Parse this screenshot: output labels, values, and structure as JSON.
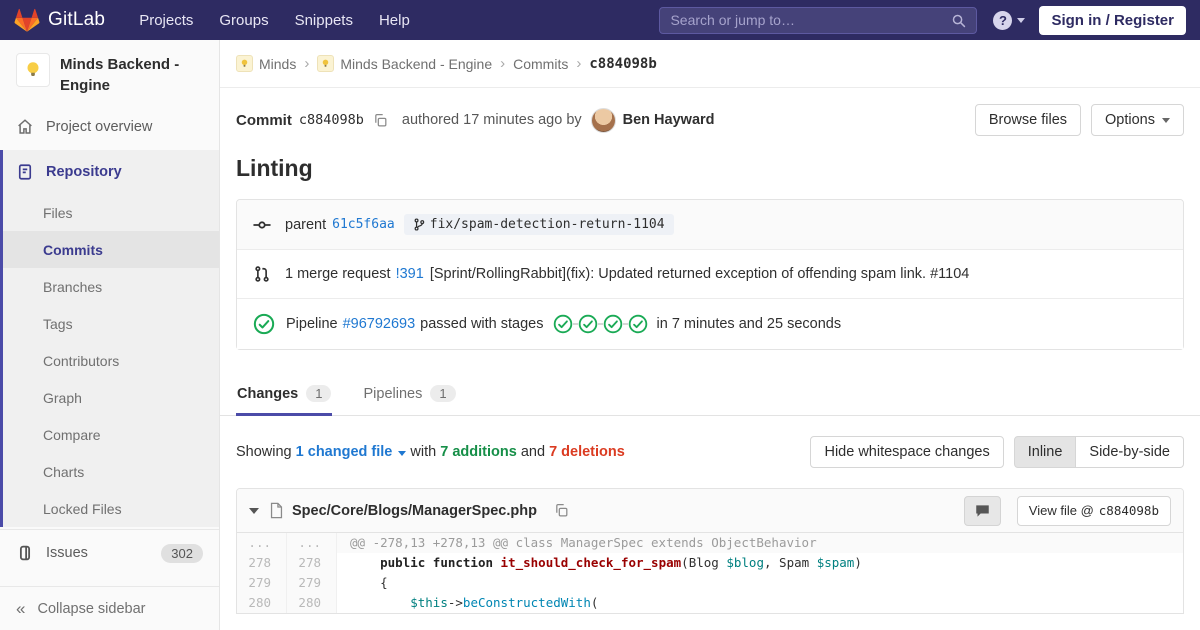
{
  "nav": {
    "logo_text": "GitLab",
    "menu": [
      "Projects",
      "Groups",
      "Snippets",
      "Help"
    ],
    "search_placeholder": "Search or jump to…",
    "sign_in": "Sign in / Register"
  },
  "sidebar": {
    "project_name": "Minds Backend - Engine",
    "overview_label": "Project overview",
    "repository": {
      "label": "Repository",
      "subitems": [
        "Files",
        "Commits",
        "Branches",
        "Tags",
        "Contributors",
        "Graph",
        "Compare",
        "Charts",
        "Locked Files"
      ],
      "active": "Commits"
    },
    "issues_label": "Issues",
    "issues_count": "302",
    "collapse_label": "Collapse sidebar"
  },
  "breadcrumb": {
    "items": [
      {
        "label": "Minds",
        "avatar": true
      },
      {
        "label": "Minds Backend - Engine",
        "avatar": true
      },
      {
        "label": "Commits",
        "avatar": false
      }
    ],
    "current": "c884098b"
  },
  "commit": {
    "label": "Commit",
    "sha": "c884098b",
    "authored_text": "authored 17 minutes ago by",
    "author": "Ben Hayward",
    "browse_files": "Browse files",
    "options": "Options",
    "title": "Linting",
    "parent_label": "parent",
    "parent_sha": "61c5f6aa",
    "branch": "fix/spam-detection-return-1104",
    "mr_prefix": "1 merge request",
    "mr_ref": "!391",
    "mr_title": "[Sprint/RollingRabbit](fix): Updated returned exception of offending spam link. #1104",
    "pipeline": {
      "label": "Pipeline",
      "id": "#96792693",
      "status_text": "passed with stages",
      "stages": 4,
      "duration_text": "in 7 minutes and 25 seconds"
    }
  },
  "tabs": {
    "changes": "Changes",
    "changes_count": "1",
    "pipelines": "Pipelines",
    "pipelines_count": "1"
  },
  "diff_controls": {
    "showing": "Showing",
    "changed_file": "1 changed file",
    "with": "with",
    "additions": "7 additions",
    "and": "and",
    "deletions": "7 deletions",
    "hide_whitespace": "Hide whitespace changes",
    "inline": "Inline",
    "side_by_side": "Side-by-side"
  },
  "file": {
    "path": "Spec/Core/Blogs/ManagerSpec.php",
    "view_file_prefix": "View file @",
    "view_file_sha": "c884098b"
  },
  "diff": {
    "rows": [
      {
        "type": "hunk",
        "old": "...",
        "new": "...",
        "segments": [
          {
            "t": "@@ -278,13 +278,13 @@ class ManagerSpec extends ObjectBehavior",
            "c": "hunk"
          }
        ]
      },
      {
        "type": "code",
        "old": "278",
        "new": "278",
        "segments": [
          {
            "t": "    ",
            "c": "p"
          },
          {
            "t": "public",
            "c": "k"
          },
          {
            "t": " ",
            "c": "p"
          },
          {
            "t": "function",
            "c": "k"
          },
          {
            "t": " ",
            "c": "p"
          },
          {
            "t": "it_should_check_for_spam",
            "c": "nf"
          },
          {
            "t": "(",
            "c": "p"
          },
          {
            "t": "Blog",
            "c": "nx"
          },
          {
            "t": " ",
            "c": "p"
          },
          {
            "t": "$blog",
            "c": "nv"
          },
          {
            "t": ", ",
            "c": "p"
          },
          {
            "t": "Spam",
            "c": "nx"
          },
          {
            "t": " ",
            "c": "p"
          },
          {
            "t": "$spam",
            "c": "nv"
          },
          {
            "t": ")",
            "c": "p"
          }
        ]
      },
      {
        "type": "code",
        "old": "279",
        "new": "279",
        "segments": [
          {
            "t": "    {",
            "c": "p"
          }
        ]
      },
      {
        "type": "code",
        "old": "280",
        "new": "280",
        "segments": [
          {
            "t": "        ",
            "c": "p"
          },
          {
            "t": "$this",
            "c": "nv"
          },
          {
            "t": "->",
            "c": "p"
          },
          {
            "t": "beConstructedWith",
            "c": "nb"
          },
          {
            "t": "(",
            "c": "p"
          }
        ]
      }
    ]
  },
  "colors": {
    "navbar_bg": "#2e2b62",
    "accent_indigo": "#4b4ba8",
    "link_blue": "#1f78d1",
    "success_green": "#1aaa55",
    "additions_green": "#168f48",
    "deletions_red": "#db3b21",
    "function_red": "#990000",
    "variable_teal": "#008080"
  }
}
